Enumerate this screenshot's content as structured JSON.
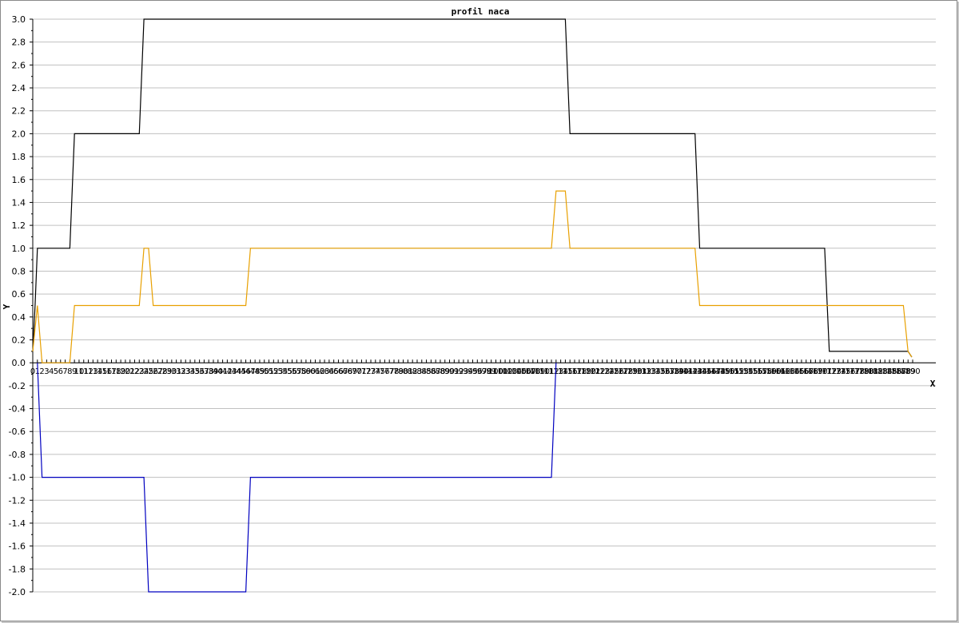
{
  "chart_data": {
    "type": "line",
    "title": "profil naca",
    "xlabel": "X",
    "ylabel": "Y",
    "ylim": [
      -2.0,
      3.0
    ],
    "xlim": [
      0,
      195
    ],
    "grid": true,
    "legend": false,
    "y_ticks": [
      "3.0",
      "2.8",
      "2.6",
      "2.4",
      "2.2",
      "2.0",
      "1.8",
      "1.6",
      "1.4",
      "1.2",
      "1.0",
      "0.8",
      "0.6",
      "0.4",
      "0.2",
      "0.0",
      "-0.2",
      "-0.4",
      "-0.6",
      "-0.8",
      "-1.0",
      "-1.2",
      "-1.4",
      "-1.6",
      "-1.8",
      "-2.0"
    ],
    "x_tick_labels": [
      "0",
      "1",
      "2",
      "3",
      "4",
      "5",
      "6",
      "7",
      "8",
      "9",
      "10",
      "11",
      "12",
      "13",
      "14",
      "15",
      "16",
      "17",
      "18",
      "19",
      "20",
      "21",
      "22",
      "23",
      "24",
      "25",
      "26",
      "27",
      "28",
      "29",
      "30",
      "31",
      "32",
      "33",
      "34",
      "35",
      "36",
      "37",
      "38",
      "39",
      "40",
      "41",
      "42",
      "43",
      "44",
      "45",
      "46",
      "47",
      "48",
      "49",
      "50",
      "51",
      "52",
      "53",
      "54",
      "55",
      "56",
      "57",
      "58",
      "59",
      "60",
      "61",
      "62",
      "63",
      "64",
      "65",
      "66",
      "67",
      "68",
      "69",
      "70",
      "71",
      "72",
      "73",
      "74",
      "75",
      "76",
      "77",
      "78",
      "79",
      "80",
      "81",
      "82",
      "83",
      "84",
      "85",
      "86",
      "87",
      "88",
      "89",
      "90",
      "91",
      "92",
      "93",
      "94",
      "95",
      "96",
      "97",
      "98",
      "99",
      "100",
      "101",
      "102",
      "103",
      "104",
      "105",
      "106",
      "107",
      "108",
      "109",
      "110",
      "111",
      "112",
      "113",
      "114",
      "115",
      "116",
      "117",
      "118",
      "119",
      "120",
      "121",
      "122",
      "123",
      "124",
      "125",
      "126",
      "127",
      "128",
      "129",
      "130",
      "131",
      "132",
      "133",
      "134",
      "135",
      "136",
      "137",
      "138",
      "139",
      "140",
      "141",
      "142",
      "143",
      "144",
      "145",
      "146",
      "147",
      "148",
      "149",
      "150",
      "151",
      "152",
      "153",
      "154",
      "155",
      "156",
      "157",
      "158",
      "159",
      "160",
      "161",
      "162",
      "163",
      "164",
      "165",
      "166",
      "167",
      "168",
      "169",
      "170",
      "171",
      "172",
      "173",
      "174",
      "175",
      "176",
      "177",
      "178",
      "179",
      "180",
      "181",
      "182",
      "183",
      "184",
      "185",
      "186",
      "187",
      "188",
      "189",
      "190"
    ],
    "series": [
      {
        "color": "#000000",
        "x": [
          0,
          0.5,
          1,
          2,
          8,
          9,
          23,
          24,
          115,
          116,
          143,
          144,
          171,
          172,
          189,
          189.8
        ],
        "y": [
          0.1,
          0.5,
          1.0,
          1.0,
          1.0,
          2.0,
          2.0,
          3.0,
          3.0,
          2.0,
          2.0,
          1.0,
          1.0,
          0.1,
          0.1,
          0.05
        ]
      },
      {
        "color": "#e8a000",
        "x": [
          0,
          1,
          2,
          8,
          9,
          23,
          24,
          25,
          26,
          46,
          47,
          112,
          113,
          115,
          116,
          143,
          144,
          188,
          189,
          189.8
        ],
        "y": [
          0.1,
          0.5,
          0.0,
          0.0,
          0.5,
          0.5,
          1.0,
          1.0,
          0.5,
          0.5,
          1.0,
          1.0,
          1.5,
          1.5,
          1.0,
          1.0,
          0.5,
          0.5,
          0.1,
          0.05
        ]
      },
      {
        "color": "#0000c0",
        "x": [
          1,
          2,
          24,
          25,
          46,
          47,
          112,
          113
        ],
        "y": [
          0.0,
          -1.0,
          -1.0,
          -2.0,
          -2.0,
          -1.0,
          -1.0,
          0.0
        ]
      }
    ]
  }
}
